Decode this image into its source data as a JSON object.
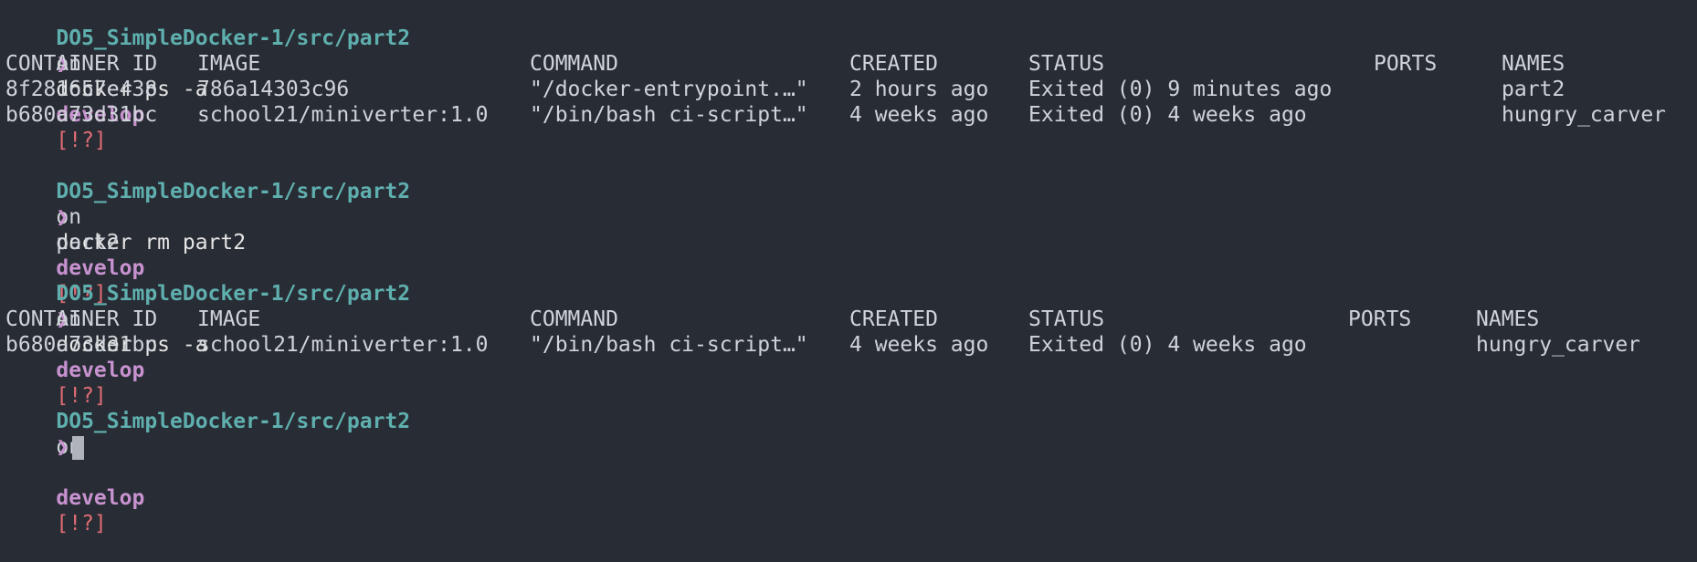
{
  "prompt": {
    "path": "DO5_SimpleDocker-1/src/part2",
    "on": "on",
    "branch_icon": "",
    "branch": "develop",
    "status": "[!?]",
    "chevron": "❯"
  },
  "blocks": [
    {
      "command": "docker ps -a",
      "table": {
        "headers": [
          "CONTAINER ID",
          "IMAGE",
          "COMMAND",
          "CREATED",
          "STATUS",
          "PORTS",
          "NAMES"
        ],
        "rows": [
          [
            "8f281657e438",
            "786a14303c96",
            "\"/docker-entrypoint.…\"",
            "2 hours ago",
            "Exited (0) 9 minutes ago",
            "",
            "part2"
          ],
          [
            "b680a73d31bc",
            "school21/miniverter:1.0",
            "\"/bin/bash ci-script…\"",
            "4 weeks ago",
            "Exited (0) 4 weeks ago",
            "",
            "hungry_carver"
          ]
        ]
      }
    },
    {
      "command": "docker rm part2",
      "output": "part2"
    },
    {
      "command": "docker ps -a",
      "table": {
        "headers": [
          "CONTAINER ID",
          "IMAGE",
          "COMMAND",
          "CREATED",
          "STATUS",
          "PORTS",
          "NAMES"
        ],
        "rows": [
          [
            "b680a73d31bc",
            "school21/miniverter:1.0",
            "\"/bin/bash ci-script…\"",
            "4 weeks ago",
            "Exited (0) 4 weeks ago",
            "",
            "hungry_carver"
          ]
        ]
      }
    }
  ],
  "colors": {
    "background": "#282c34",
    "path": "#5fafaf",
    "branch": "#c792cf",
    "status": "#e06c75",
    "text": "#d0d4da"
  }
}
